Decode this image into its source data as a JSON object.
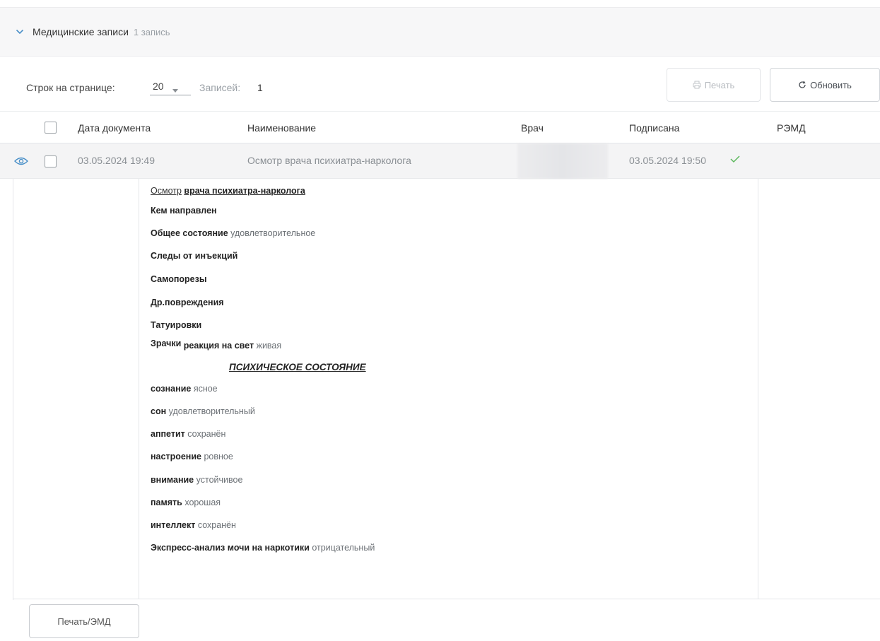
{
  "section": {
    "title": "Медицинские записи",
    "count": "1 запись"
  },
  "toolbar": {
    "rows_label": "Строк на странице:",
    "rows_value": "20",
    "records_label": "Записей:",
    "records_count": "1",
    "print_label": "Печать",
    "refresh_label": "Обновить"
  },
  "table": {
    "headers": {
      "date": "Дата документа",
      "name": "Наименование",
      "doctor": "Врач",
      "signed": "Подписана",
      "remd": "РЭМД"
    },
    "row": {
      "date": "03.05.2024 19:49",
      "name": "Осмотр врача психиатра-нарколога",
      "signed": "03.05.2024 19:50"
    }
  },
  "document": {
    "title_plain": "Осмотр",
    "title_bold": "врача психиатра-нарколога",
    "fields": [
      {
        "label": "Кем направлен",
        "value": ""
      },
      {
        "label": "Общее состояние",
        "value": "удовлетворительное"
      },
      {
        "label": "Следы от инъекций",
        "value": ""
      },
      {
        "label": "Самопорезы",
        "value": ""
      },
      {
        "label": "Др.повреждения",
        "value": ""
      },
      {
        "label": "Татуировки",
        "value": ""
      }
    ],
    "pupils_label": "Зрачки",
    "pupils_sub_label": "реакция на свет",
    "pupils_value": "живая",
    "psych_heading": "ПСИХИЧЕСКОЕ СОСТОЯНИЕ",
    "psych_fields": [
      {
        "label": "сознание",
        "value": "ясное"
      },
      {
        "label": "сон",
        "value": "удовлетворительный"
      },
      {
        "label": "аппетит",
        "value": "сохранён"
      },
      {
        "label": "настроение",
        "value": "ровное"
      },
      {
        "label": "внимание",
        "value": "устойчивое"
      },
      {
        "label": "память",
        "value": "хорошая"
      },
      {
        "label": "интеллект",
        "value": "сохранён"
      },
      {
        "label": "Экспресс-анализ мочи на наркотики",
        "value": "отрицательный"
      }
    ]
  },
  "footer": {
    "print_emd_label": "Печать/ЭМД"
  },
  "colors": {
    "accent": "#4a90c8",
    "signed_check": "#5cb85c"
  }
}
